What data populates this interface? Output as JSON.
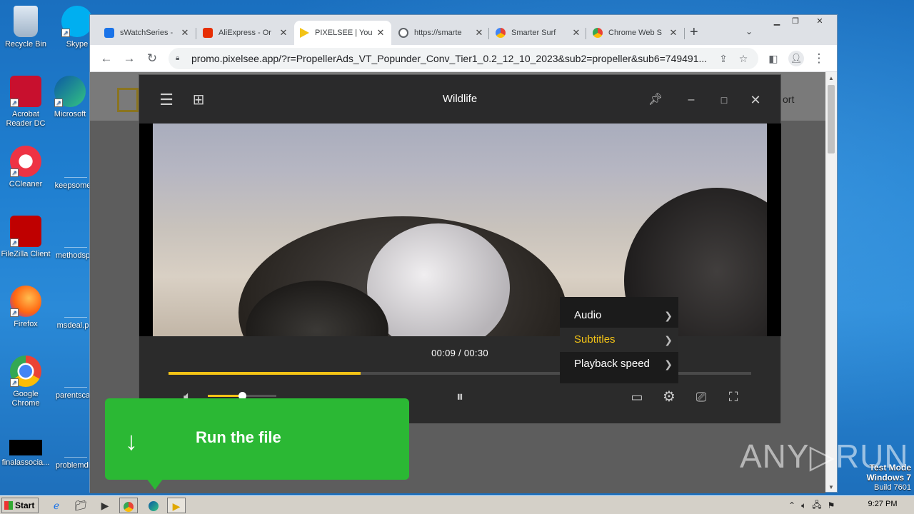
{
  "desktop": {
    "icons": [
      {
        "label": "Recycle Bin"
      },
      {
        "label": "Skype"
      },
      {
        "label": "Acrobat Reader DC"
      },
      {
        "label": "Microsoft"
      },
      {
        "label": "CCleaner"
      },
      {
        "label": "keepsome"
      },
      {
        "label": "FileZilla Client"
      },
      {
        "label": "methodsp"
      },
      {
        "label": "Firefox"
      },
      {
        "label": "msdeal.p"
      },
      {
        "label": "Google Chrome"
      },
      {
        "label": "parentsca"
      },
      {
        "label": "finalassocia..."
      },
      {
        "label": "problemdi"
      }
    ]
  },
  "browser": {
    "tabs": [
      {
        "label": "sWatchSeries -",
        "color": "#1a73e8",
        "active": false
      },
      {
        "label": "AliExpress - Or",
        "color": "#e62e04",
        "active": false
      },
      {
        "label": "PIXELSEE | You",
        "color": "#f3c316",
        "active": true
      },
      {
        "label": "https://smarte",
        "color": "#5f6368",
        "active": false
      },
      {
        "label": "Smarter Surf",
        "color": "#4285f4",
        "active": false
      },
      {
        "label": "Chrome Web S",
        "color": "#34a853",
        "active": false
      }
    ],
    "url": "promo.pixelsee.app/?r=PropellerAds_VT_Popunder_Conv_Tier1_0.2_12_10_2023&sub2=propeller&sub6=749491..."
  },
  "site": {
    "support_text": "ort"
  },
  "player": {
    "title": "Wildlife",
    "time": "00:09 / 00:30",
    "progress_fraction": 0.33,
    "volume_fraction": 0.5,
    "settings_menu": [
      {
        "label": "Audio",
        "highlighted": false
      },
      {
        "label": "Subtitles",
        "highlighted": true
      },
      {
        "label": "Playback speed",
        "highlighted": false
      }
    ],
    "accent_color": "#f3c316"
  },
  "ad": {
    "label": "Run the file",
    "color": "#2bb834"
  },
  "watermark": {
    "text": "ANY▷RUN",
    "mode": "Test Mode",
    "os": "Windows 7",
    "build": "Build 7601"
  },
  "taskbar": {
    "start_label": "Start",
    "clock": "9:27 PM"
  }
}
